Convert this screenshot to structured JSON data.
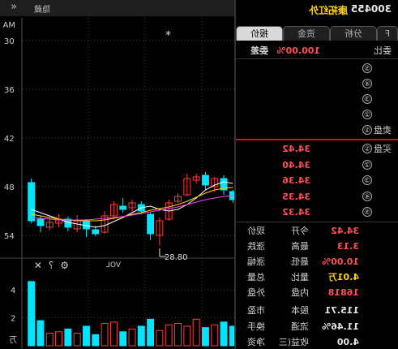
{
  "header": {
    "code": "300455",
    "name": "康拓红外"
  },
  "tabs": [
    "报价",
    "资金",
    "分析",
    "F"
  ],
  "order_book": {
    "wei_bi_label": "委比",
    "wei_bi_value": "100.00%",
    "wei_cha_label": "委差",
    "sell_label": "卖盘",
    "buy_label": "买盘",
    "sell_levels": [
      "⑤",
      "④",
      "③",
      "②",
      "①"
    ],
    "buy_levels": [
      {
        "n": "①",
        "price": "34.42"
      },
      {
        "n": "②",
        "price": "34.40"
      },
      {
        "n": "③",
        "price": "34.36"
      },
      {
        "n": "④",
        "price": "34.35"
      },
      {
        "n": "⑤",
        "price": "34.32"
      }
    ]
  },
  "quote": {
    "rows": [
      {
        "k1": "现价",
        "v1": "34.42",
        "k2": "今开",
        "v2": ""
      },
      {
        "k1": "涨跌",
        "v1": "3.13",
        "k2": "最高",
        "v2": ""
      },
      {
        "k1": "涨幅",
        "v1": "10.00%",
        "k2": "最低",
        "v2": ""
      },
      {
        "k1": "总量",
        "v1": "4.01万",
        "k2": "量比",
        "v2": ""
      },
      {
        "k1": "外盘",
        "v1": "16818",
        "k2": "内盘",
        "v2": ""
      },
      {
        "k1": "市盈",
        "v1": "115.71",
        "k2": "股本",
        "v2": ""
      },
      {
        "k1": "换手",
        "v1": "11.46%",
        "k2": "流通",
        "v2": ""
      },
      {
        "k1": "净资",
        "v1": "4.00",
        "k2": "收益(三",
        "v2": ""
      }
    ]
  },
  "chart": {
    "hide_label": "隐藏",
    "ma_label": "MA",
    "volume_label": "VOL",
    "volume_unit": "万",
    "low_marker": "28.80",
    "y_ticks": [
      "54",
      "48",
      "42",
      "36",
      "30"
    ],
    "vol_ticks": [
      "4",
      "2"
    ],
    "colors": {
      "up": "#ff3c3c",
      "down": "#00e5ff",
      "ma5": "#ffffff",
      "ma10": "#ffd200",
      "ma20": "#ff40ff"
    }
  },
  "chart_data": {
    "type": "candlestick",
    "ylim": [
      28,
      56
    ],
    "candles": [
      {
        "o": 36.5,
        "c": 31.8,
        "h": 37.0,
        "l": 31.5
      },
      {
        "o": 32.0,
        "c": 31.2,
        "h": 32.4,
        "l": 30.4
      },
      {
        "o": 31.0,
        "c": 31.6,
        "h": 32.2,
        "l": 30.6
      },
      {
        "o": 31.5,
        "c": 32.0,
        "h": 32.6,
        "l": 31.0
      },
      {
        "o": 32.0,
        "c": 31.0,
        "h": 32.3,
        "l": 30.5
      },
      {
        "o": 30.8,
        "c": 31.8,
        "h": 32.5,
        "l": 30.4
      },
      {
        "o": 31.8,
        "c": 30.8,
        "h": 32.0,
        "l": 29.8
      },
      {
        "o": 30.7,
        "c": 30.2,
        "h": 31.2,
        "l": 29.9
      },
      {
        "o": 30.4,
        "c": 32.4,
        "h": 33.0,
        "l": 30.2
      },
      {
        "o": 32.4,
        "c": 33.8,
        "h": 34.2,
        "l": 32.0
      },
      {
        "o": 33.6,
        "c": 33.2,
        "h": 34.6,
        "l": 32.8
      },
      {
        "o": 33.4,
        "c": 34.0,
        "h": 34.4,
        "l": 32.9
      },
      {
        "o": 33.8,
        "c": 33.0,
        "h": 34.2,
        "l": 32.6
      },
      {
        "o": 32.6,
        "c": 30.2,
        "h": 32.8,
        "l": 29.4
      },
      {
        "o": 30.0,
        "c": 31.8,
        "h": 32.2,
        "l": 28.8
      },
      {
        "o": 32.0,
        "c": 34.0,
        "h": 34.4,
        "l": 31.8
      },
      {
        "o": 34.2,
        "c": 34.8,
        "h": 35.2,
        "l": 34.0
      },
      {
        "o": 35.0,
        "c": 37.0,
        "h": 37.6,
        "l": 34.8
      },
      {
        "o": 36.8,
        "c": 37.2,
        "h": 37.6,
        "l": 36.4
      },
      {
        "o": 37.4,
        "c": 36.2,
        "h": 37.8,
        "l": 35.6
      },
      {
        "o": 36.0,
        "c": 37.0,
        "h": 37.2,
        "l": 35.4
      },
      {
        "o": 37.0,
        "c": 35.6,
        "h": 37.4,
        "l": 35.0
      },
      {
        "o": 35.4,
        "c": 34.4,
        "h": 35.6,
        "l": 34.0
      }
    ],
    "ma5": [
      33.2,
      32.8,
      32.4,
      32.0,
      31.6,
      31.4,
      31.2,
      31.0,
      31.2,
      31.7,
      32.2,
      32.8,
      33.4,
      33.6,
      33.2,
      33.0,
      33.2,
      33.8,
      34.6,
      35.6,
      36.2,
      36.6,
      36.4
    ],
    "ma10": [
      32.6,
      32.4,
      32.2,
      32.0,
      31.9,
      31.8,
      31.8,
      31.8,
      31.9,
      32.1,
      32.3,
      32.6,
      32.8,
      33.1,
      33.3,
      33.5,
      33.8,
      34.2,
      34.7,
      35.2,
      35.6,
      35.8,
      35.9
    ],
    "ma20": [
      32.2,
      32.1,
      32.0,
      31.9,
      31.9,
      31.9,
      31.9,
      32.0,
      32.1,
      32.2,
      32.3,
      32.5,
      32.7,
      32.9,
      33.1,
      33.3,
      33.5,
      33.8,
      34.1,
      34.4,
      34.6,
      34.8,
      34.9
    ],
    "volumes": [
      4.6,
      1.8,
      0.9,
      1.0,
      1.2,
      0.9,
      1.4,
      0.8,
      1.6,
      1.7,
      1.0,
      1.2,
      1.4,
      1.9,
      1.1,
      1.5,
      1.6,
      1.4,
      1.9,
      1.3,
      1.5,
      1.7,
      1.4
    ],
    "vol_ylim": [
      0,
      5
    ]
  }
}
